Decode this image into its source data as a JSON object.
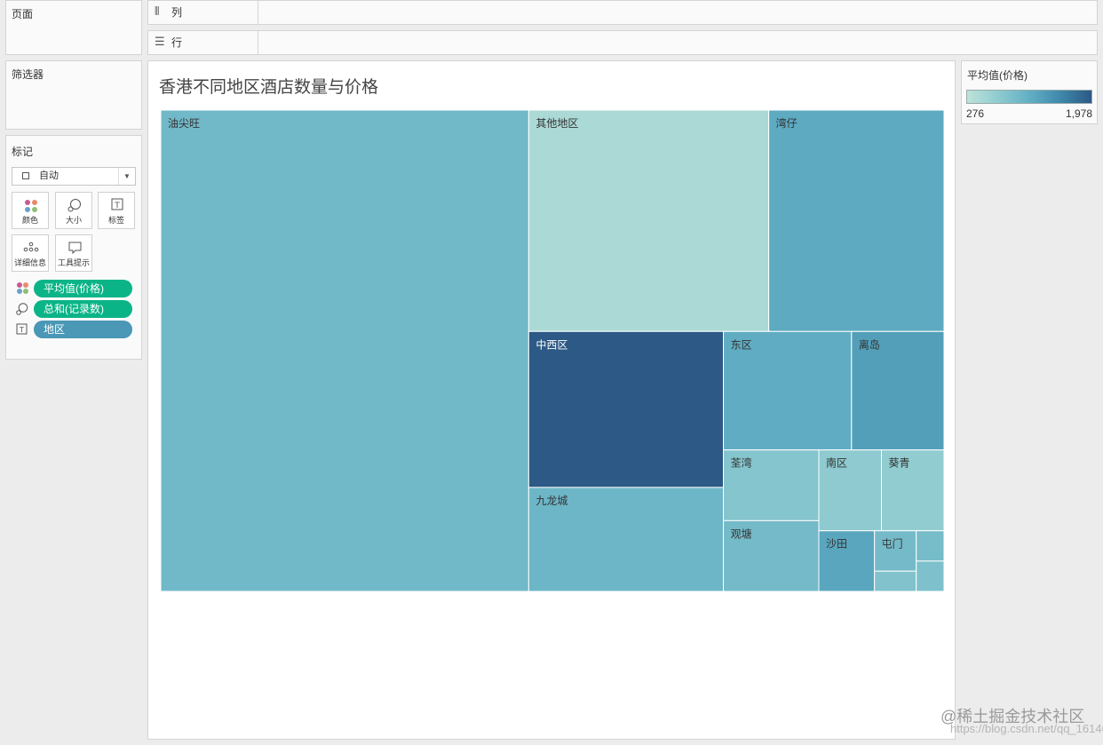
{
  "pages_card": {
    "title": "页面"
  },
  "filters_card": {
    "title": "筛选器"
  },
  "marks_card": {
    "title": "标记",
    "mark_type": "自动",
    "buttons": {
      "color": "颜色",
      "size": "大小",
      "label": "标签",
      "detail": "详细信息",
      "tooltip": "工具提示"
    },
    "pills": {
      "color": "平均值(价格)",
      "size": "总和(记录数)",
      "label": "地区"
    }
  },
  "shelves": {
    "columns": "列",
    "rows": "行"
  },
  "view": {
    "title": "香港不同地区酒店数量与价格"
  },
  "legend": {
    "title": "平均值(价格)",
    "min": "276",
    "max": "1,978",
    "color_low": "#bde3d9",
    "color_high": "#2c5985"
  },
  "colors": {
    "pill_measure": "#0bb487",
    "pill_dimension": "#4a97b6"
  },
  "icons": {
    "columns": "columns-icon",
    "rows": "rows-icon",
    "color": "color-dots-icon",
    "size": "size-circle-icon",
    "label": "label-t-icon",
    "detail": "detail-dots-icon",
    "tooltip": "tooltip-bubble-icon"
  },
  "chart_data": {
    "type": "treemap",
    "title": "香港不同地区酒店数量与价格",
    "size_measure": "总和(记录数)",
    "color_measure": "平均值(价格)",
    "color_range": [
      276,
      1978
    ],
    "items": [
      {
        "label": "油尖旺",
        "count": 210,
        "avg_price": 620
      },
      {
        "label": "其他地区",
        "count": 63,
        "avg_price": 300
      },
      {
        "label": "湾仔",
        "count": 46,
        "avg_price": 820
      },
      {
        "label": "中西区",
        "count": 36,
        "avg_price": 1978
      },
      {
        "label": "九龙城",
        "count": 24,
        "avg_price": 660
      },
      {
        "label": "东区",
        "count": 18,
        "avg_price": 780
      },
      {
        "label": "离岛",
        "count": 13,
        "avg_price": 960
      },
      {
        "label": "荃湾",
        "count": 8,
        "avg_price": 470
      },
      {
        "label": "观塘",
        "count": 8,
        "avg_price": 600
      },
      {
        "label": "南区",
        "count": 6,
        "avg_price": 420
      },
      {
        "label": "葵青",
        "count": 6,
        "avg_price": 400
      },
      {
        "label": "沙田",
        "count": 4,
        "avg_price": 860
      },
      {
        "label": "屯门",
        "count": 2,
        "avg_price": 600
      },
      {
        "label": "",
        "count": 1,
        "avg_price": 500
      },
      {
        "label": "",
        "count": 1,
        "avg_price": 580
      },
      {
        "label": "",
        "count": 1,
        "avg_price": 520
      }
    ]
  },
  "watermark": {
    "line1": "@稀土掘金技术社区",
    "line2": "https://blog.csdn.net/qq_16146103"
  }
}
